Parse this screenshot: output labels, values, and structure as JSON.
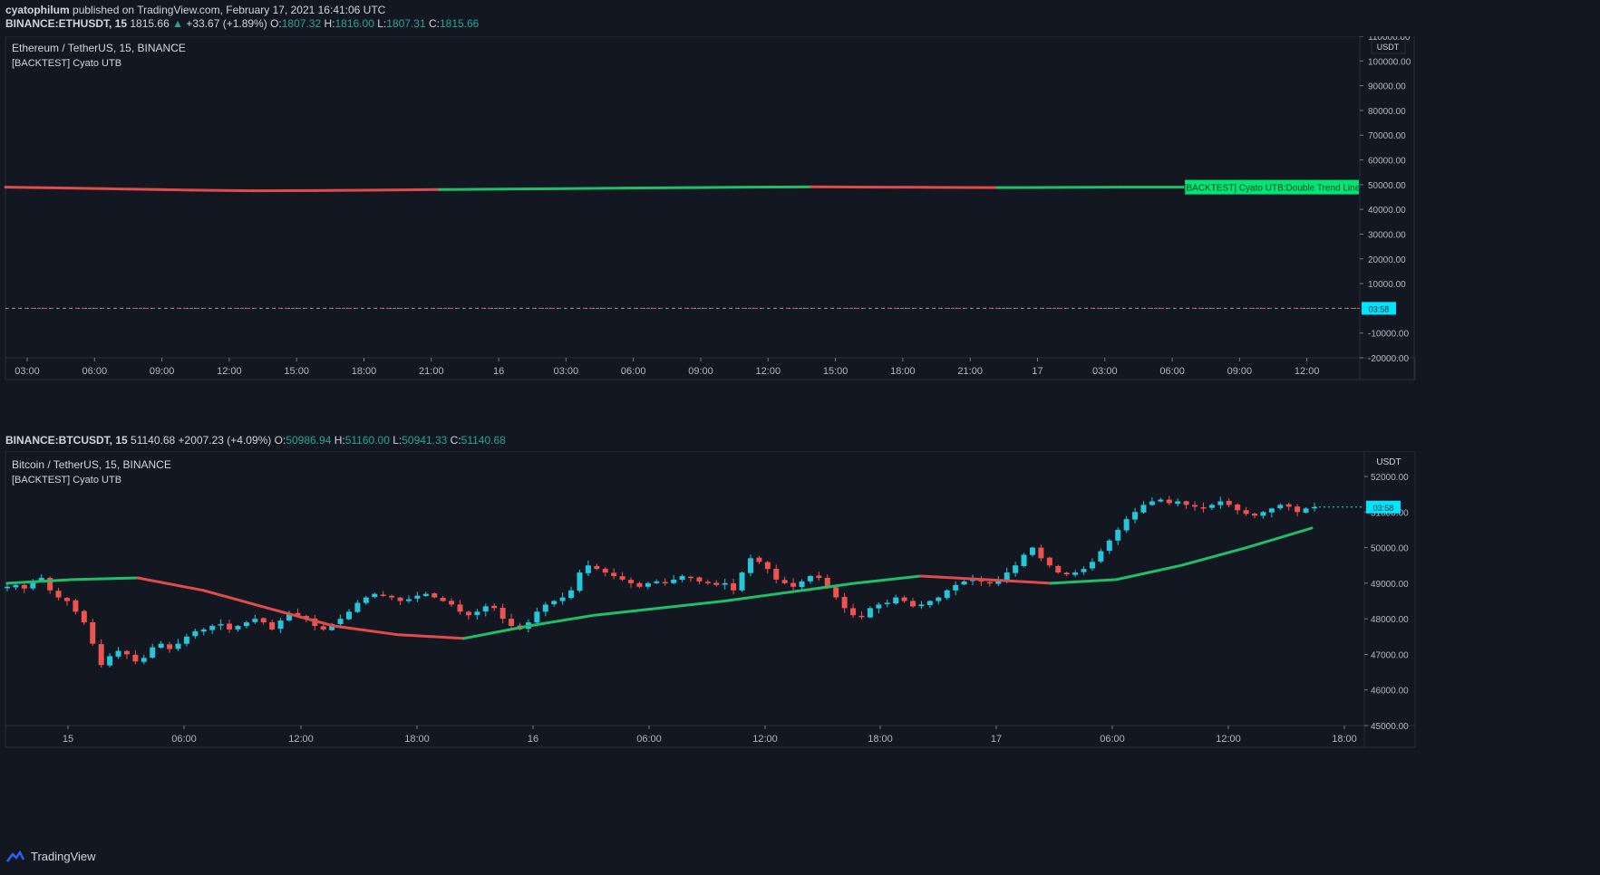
{
  "top_line": {
    "author": "cyatophilum",
    "rest": " published on TradingView.com, February 17, 2021 16:41:06 UTC"
  },
  "eth_header": {
    "symbol": "BINANCE:ETHUSDT, 15",
    "last": "1815.66",
    "change": "+33.67 (+1.89%)",
    "o_label": "O:",
    "o": "1807.32",
    "h_label": "H:",
    "h": "1816.00",
    "l_label": "L:",
    "l": "1807.31",
    "c_label": "C:",
    "c": "1815.66"
  },
  "btc_header": {
    "symbol": "BINANCE:BTCUSDT, 15",
    "last": "51140.68",
    "change": "+2007.23 (+4.09%)",
    "o_label": "O:",
    "o": "50986.94",
    "h_label": "H:",
    "h": "51160.00",
    "l_label": "L:",
    "l": "50941.33",
    "c_label": "C:",
    "c": "51140.68"
  },
  "footer": {
    "brand": "TradingView"
  },
  "colors": {
    "bg": "#131722",
    "up": "#26c6da",
    "down": "#ef5350",
    "trend_up": "#1fbf6a",
    "trend_down": "#e04b4b",
    "grid": "#1e2230",
    "badge": "#00e5ff",
    "label_green": "#00e676"
  },
  "chart_data": [
    {
      "type": "line",
      "title": "Ethereum / TetherUS, 15, BINANCE",
      "indicator": "[BACKTEST] Cyato UTB",
      "unit": "USDT",
      "ylim": [
        -20000,
        110000
      ],
      "y_ticks": [
        "110000.00",
        "100000.00",
        "90000.00",
        "80000.00",
        "70000.00",
        "60000.00",
        "50000.00",
        "40000.00",
        "30000.00",
        "20000.00",
        "10000.00",
        "-10000.00",
        "-20000.00"
      ],
      "x_ticks": [
        "03:00",
        "06:00",
        "09:00",
        "12:00",
        "15:00",
        "18:00",
        "21:00",
        "16",
        "03:00",
        "06:00",
        "09:00",
        "12:00",
        "15:00",
        "18:00",
        "21:00",
        "17",
        "03:00",
        "06:00",
        "09:00",
        "12:00"
      ],
      "series_label": "[BACKTEST] Cyato UTB:Double Trend Line",
      "countdown": "03:58",
      "series": [
        {
          "values_approx": [
            49000,
            48600,
            48200,
            47800,
            47500,
            47600,
            47800,
            48000,
            48200,
            48400,
            48600,
            48800,
            49000,
            49100,
            49000,
            48900,
            48800,
            48900,
            49000,
            49000
          ]
        }
      ]
    },
    {
      "type": "candlestick",
      "title": "Bitcoin / TetherUS, 15, BINANCE",
      "indicator": "[BACKTEST] Cyato UTB",
      "unit": "USDT",
      "ylim": [
        45000,
        52000
      ],
      "y_ticks": [
        "52000.00",
        "51000.00",
        "50000.00",
        "49000.00",
        "48000.00",
        "47000.00",
        "46000.00",
        "45000.00"
      ],
      "x_ticks": [
        "15",
        "06:00",
        "12:00",
        "18:00",
        "16",
        "06:00",
        "12:00",
        "18:00",
        "17",
        "06:00",
        "12:00",
        "18:00"
      ],
      "countdown": "03:58",
      "close_path": [
        48900,
        48950,
        48850,
        49050,
        49150,
        48800,
        48600,
        48500,
        48200,
        47900,
        47300,
        46700,
        46950,
        47100,
        47000,
        46800,
        46900,
        47200,
        47300,
        47150,
        47300,
        47500,
        47650,
        47700,
        47800,
        47850,
        47700,
        47800,
        47900,
        48000,
        47900,
        47700,
        47950,
        48150,
        48100,
        48000,
        47800,
        47700,
        47850,
        48000,
        48200,
        48450,
        48600,
        48700,
        48650,
        48600,
        48500,
        48550,
        48650,
        48700,
        48600,
        48500,
        48400,
        48200,
        48100,
        48200,
        48350,
        48300,
        48000,
        47800,
        47700,
        47900,
        48200,
        48400,
        48500,
        48600,
        48800,
        49300,
        49500,
        49400,
        49300,
        49200,
        49100,
        49000,
        48900,
        49000,
        49050,
        49000,
        49100,
        49200,
        49150,
        49050,
        49000,
        48950,
        49000,
        48800,
        49300,
        49700,
        49600,
        49400,
        49100,
        49000,
        48900,
        49050,
        49200,
        49150,
        48900,
        48600,
        48300,
        48100,
        48050,
        48300,
        48400,
        48450,
        48600,
        48500,
        48350,
        48400,
        48500,
        48600,
        48800,
        48950,
        49050,
        49100,
        49050,
        49000,
        49100,
        49300,
        49500,
        49800,
        50000,
        49700,
        49500,
        49300,
        49250,
        49300,
        49400,
        49600,
        49900,
        50200,
        50500,
        50800,
        51000,
        51200,
        51300,
        51350,
        51250,
        51300,
        51200,
        51150,
        51100,
        51200,
        51300,
        51200,
        51050,
        50950,
        50900,
        51000,
        51100,
        51200,
        51150,
        51000,
        51100,
        51140
      ],
      "trend_line": {
        "segments": [
          {
            "color": "trend_up",
            "values": [
              49000,
              49100,
              49150
            ]
          },
          {
            "color": "trend_down",
            "values": [
              49150,
              48800,
              48300,
              47800,
              47550,
              47450
            ]
          },
          {
            "color": "trend_up",
            "values": [
              47450,
              47800,
              48100,
              48300,
              48500,
              48750,
              49000,
              49200
            ]
          },
          {
            "color": "trend_down",
            "values": [
              49200,
              49100,
              49000
            ]
          },
          {
            "color": "trend_up",
            "values": [
              49000,
              49100,
              49500,
              50000,
              50550
            ]
          }
        ]
      }
    }
  ]
}
